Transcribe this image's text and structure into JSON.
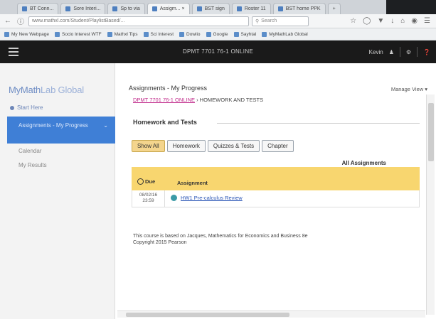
{
  "browser": {
    "tabs": [
      {
        "label": "BT Conn...",
        "active": false
      },
      {
        "label": "Sore Interi...",
        "active": false
      },
      {
        "label": "Sp to via",
        "active": false
      },
      {
        "label": "Assigm... ×",
        "active": true
      },
      {
        "label": "BST sign",
        "active": false
      },
      {
        "label": "Roster 11",
        "active": false
      },
      {
        "label": "BST home PPK",
        "active": false
      },
      {
        "label": "+",
        "active": false
      }
    ],
    "url": "www.mathxl.com/Student/PlaylistBased/...",
    "search_placeholder": "Search",
    "bookmarks": [
      "My New Webpage",
      "Socio Interest WTF",
      "Mathxl Tips",
      "Sci Interest",
      "Dowlio",
      "Google",
      "Sayhtal",
      "MyMathLab Global"
    ]
  },
  "app": {
    "course_title": "DPMT 7701 76-1 ONLINE",
    "user": "Kevin",
    "brand_my": "MyMath",
    "brand_rest": "Lab Global"
  },
  "sidebar": {
    "home": "Start Here",
    "active": "Assignments - My Progress",
    "items": [
      "Calendar",
      "My Results"
    ]
  },
  "main": {
    "title": "Assignments - My Progress",
    "manage_view": "Manage View ▾",
    "breadcrumb_link": "DPMT 7701 76-1 ONLINE",
    "breadcrumb_rest": " › HOMEWORK AND TESTS",
    "section_title": "Homework and Tests",
    "filters": [
      "Show All",
      "Homework",
      "Quizzes & Tests",
      "Chapter"
    ],
    "all_assignments": "All Assignments",
    "col_due": "Due",
    "col_assignment": "Assignment",
    "rows": [
      {
        "due_date": "08/02/16",
        "due_time": "23:59",
        "assignment": "HW1 Pre-calculus Review"
      }
    ],
    "footer_line1": "This course is based on Jacques, Mathematics for Economics and Business 8e",
    "footer_line2": "Copyright 2015 Pearson"
  }
}
